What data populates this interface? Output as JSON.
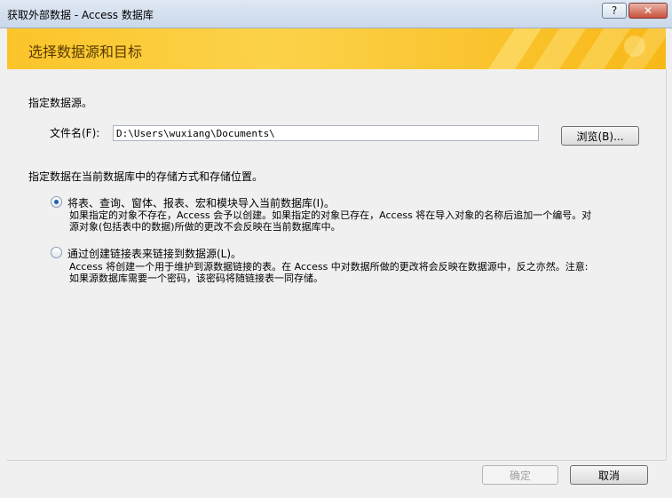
{
  "window": {
    "title": "获取外部数据 - Access 数据库",
    "help_label": "?",
    "close_label": "✕"
  },
  "header": {
    "title": "选择数据源和目标"
  },
  "source": {
    "heading": "指定数据源。",
    "filename_label": "文件名(F):",
    "filename_value": "D:\\Users\\wuxiang\\Documents\\",
    "browse_label": "浏览(B)..."
  },
  "storage": {
    "heading": "指定数据在当前数据库中的存储方式和存储位置。",
    "options": [
      {
        "label": "将表、查询、窗体、报表、宏和模块导入当前数据库(I)。",
        "selected": true,
        "description_line1": "如果指定的对象不存在，Access 会予以创建。如果指定的对象已存在，Access 将在导入对象的名称后追加一个编号。对",
        "description_line2": "源对象(包括表中的数据)所做的更改不会反映在当前数据库中。"
      },
      {
        "label": "通过创建链接表来链接到数据源(L)。",
        "selected": false,
        "description_line1": "Access 将创建一个用于维护到源数据链接的表。在 Access 中对数据所做的更改将会反映在数据源中，反之亦然。注意:",
        "description_line2": "如果源数据库需要一个密码，该密码将随链接表一同存储。"
      }
    ]
  },
  "footer": {
    "ok_label": "确定",
    "cancel_label": "取消"
  },
  "colors": {
    "header_accent": "#fbc52a",
    "radio_selected": "#1a5fb4"
  }
}
